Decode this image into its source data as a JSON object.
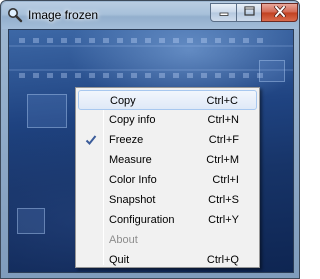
{
  "window": {
    "title": "Image frozen",
    "app_icon": "magnifier-icon",
    "controls": {
      "minimize_icon": "minimize-icon",
      "maximize_icon": "maximize-icon",
      "close_icon": "close-icon"
    }
  },
  "context_menu": {
    "items": [
      {
        "label": "Copy",
        "shortcut": "Ctrl+C",
        "checked": false,
        "enabled": true,
        "highlighted": true
      },
      {
        "label": "Copy info",
        "shortcut": "Ctrl+N",
        "checked": false,
        "enabled": true,
        "highlighted": false
      },
      {
        "label": "Freeze",
        "shortcut": "Ctrl+F",
        "checked": true,
        "enabled": true,
        "highlighted": false
      },
      {
        "label": "Measure",
        "shortcut": "Ctrl+M",
        "checked": false,
        "enabled": true,
        "highlighted": false
      },
      {
        "label": "Color Info",
        "shortcut": "Ctrl+I",
        "checked": false,
        "enabled": true,
        "highlighted": false
      },
      {
        "label": "Snapshot",
        "shortcut": "Ctrl+S",
        "checked": false,
        "enabled": true,
        "highlighted": false
      },
      {
        "label": "Configuration",
        "shortcut": "Ctrl+Y",
        "checked": false,
        "enabled": true,
        "highlighted": false
      },
      {
        "label": "About",
        "shortcut": "",
        "checked": false,
        "enabled": false,
        "highlighted": false
      },
      {
        "label": "Quit",
        "shortcut": "Ctrl+Q",
        "checked": false,
        "enabled": true,
        "highlighted": false
      }
    ]
  },
  "colors": {
    "menu_highlight_border": "#a8c8ef",
    "check_mark": "#3b5c9a",
    "disabled_text": "#8d8d8d"
  }
}
